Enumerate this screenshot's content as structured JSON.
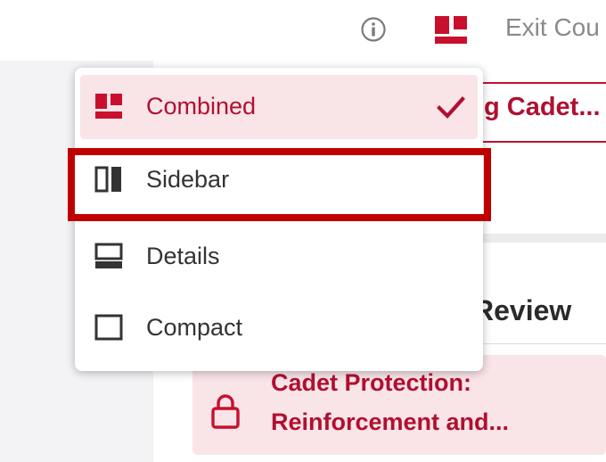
{
  "header": {
    "info_icon": "info-icon",
    "layout_icon": "combined-layout-icon",
    "exit_label": "Exit Cou"
  },
  "menu": {
    "items": [
      {
        "label": "Combined",
        "icon": "combined-layout-icon",
        "selected": true
      },
      {
        "label": "Sidebar",
        "icon": "sidebar-layout-icon",
        "selected": false
      },
      {
        "label": "Details",
        "icon": "details-layout-icon",
        "selected": false
      },
      {
        "label": "Compact",
        "icon": "compact-layout-icon",
        "selected": false
      }
    ],
    "check_icon": "checkmark-icon"
  },
  "background": {
    "cadet_card_text": "g Cadet...",
    "review_text": "Review",
    "protection_line1": "Cadet Protection:",
    "protection_line2": "Reinforcement and..."
  },
  "colors": {
    "brand_red": "#c8102e",
    "selected_bg": "#f9e4e8",
    "highlight": "#c00000",
    "text": "#333333",
    "muted": "#8a8a8a"
  }
}
